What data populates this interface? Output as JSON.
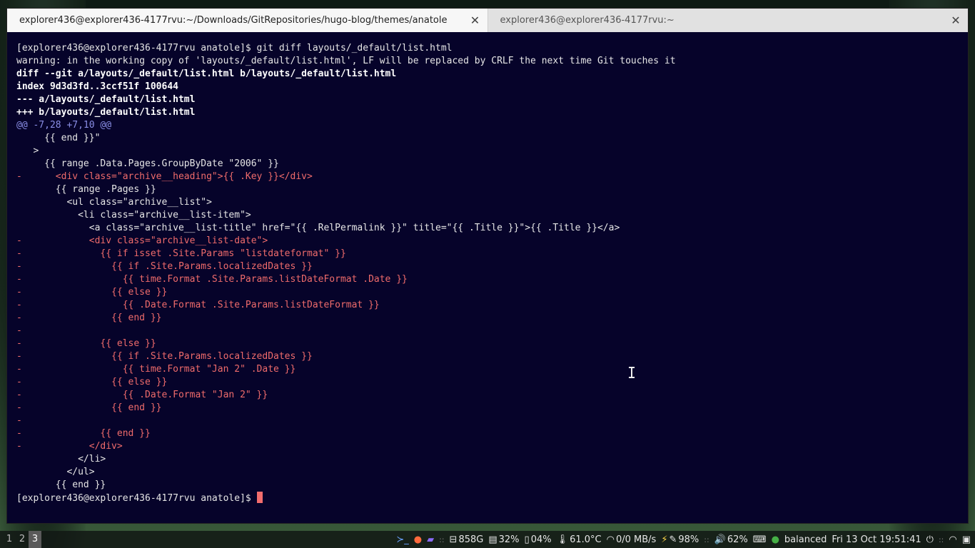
{
  "tabs": [
    {
      "title": "explorer436@explorer436-4177rvu:~/Downloads/GitRepositories/hugo-blog/themes/anatole",
      "active": true
    },
    {
      "title": "explorer436@explorer436-4177rvu:~",
      "active": false
    }
  ],
  "terminal_lines": [
    {
      "text": "[explorer436@explorer436-4177rvu anatole]$ git diff layouts/_default/list.html",
      "kind": "plain"
    },
    {
      "text": "warning: in the working copy of 'layouts/_default/list.html', LF will be replaced by CRLF the next time Git touches it",
      "kind": "plain"
    },
    {
      "text": "diff --git a/layouts/_default/list.html b/layouts/_default/list.html",
      "kind": "bold"
    },
    {
      "text": "index 9d3d3fd..3ccf51f 100644",
      "kind": "bold"
    },
    {
      "text": "--- a/layouts/_default/list.html",
      "kind": "bold"
    },
    {
      "text": "+++ b/layouts/_default/list.html",
      "kind": "bold"
    },
    {
      "text": "@@ -7,28 +7,10 @@",
      "kind": "hunk"
    },
    {
      "text": "     {{ end }}\"",
      "kind": "plain"
    },
    {
      "text": "   >",
      "kind": "plain"
    },
    {
      "text": "     {{ range .Data.Pages.GroupByDate \"2006\" }}",
      "kind": "plain"
    },
    {
      "text": "-      <div class=\"archive__heading\">{{ .Key }}</div>",
      "kind": "del"
    },
    {
      "text": "       {{ range .Pages }}",
      "kind": "plain"
    },
    {
      "text": "         <ul class=\"archive__list\">",
      "kind": "plain"
    },
    {
      "text": "           <li class=\"archive__list-item\">",
      "kind": "plain"
    },
    {
      "text": "             <a class=\"archive__list-title\" href=\"{{ .RelPermalink }}\" title=\"{{ .Title }}\">{{ .Title }}</a>",
      "kind": "plain"
    },
    {
      "text": "-            <div class=\"archive__list-date\">",
      "kind": "del"
    },
    {
      "text": "-              {{ if isset .Site.Params \"listdateformat\" }}",
      "kind": "del"
    },
    {
      "text": "-                {{ if .Site.Params.localizedDates }}",
      "kind": "del"
    },
    {
      "text": "-                  {{ time.Format .Site.Params.listDateFormat .Date }}",
      "kind": "del"
    },
    {
      "text": "-                {{ else }}",
      "kind": "del"
    },
    {
      "text": "-                  {{ .Date.Format .Site.Params.listDateFormat }}",
      "kind": "del"
    },
    {
      "text": "-                {{ end }}",
      "kind": "del"
    },
    {
      "text": "-",
      "kind": "del"
    },
    {
      "text": "-              {{ else }}",
      "kind": "del"
    },
    {
      "text": "-                {{ if .Site.Params.localizedDates }}",
      "kind": "del"
    },
    {
      "text": "-                  {{ time.Format \"Jan 2\" .Date }}",
      "kind": "del"
    },
    {
      "text": "-                {{ else }}",
      "kind": "del"
    },
    {
      "text": "-                  {{ .Date.Format \"Jan 2\" }}",
      "kind": "del"
    },
    {
      "text": "-                {{ end }}",
      "kind": "del"
    },
    {
      "text": "-",
      "kind": "del"
    },
    {
      "text": "-              {{ end }}",
      "kind": "del"
    },
    {
      "text": "-            </div>",
      "kind": "del"
    },
    {
      "text": "           </li>",
      "kind": "plain"
    },
    {
      "text": "         </ul>",
      "kind": "plain"
    },
    {
      "text": "       {{ end }}",
      "kind": "plain"
    }
  ],
  "prompt": "[explorer436@explorer436-4177rvu anatole]$ ",
  "taskbar": {
    "workspaces": [
      "1",
      "2",
      "3"
    ],
    "active_workspace": "3",
    "disk": "858G",
    "memory": "32%",
    "battery_small": "04%",
    "temperature": "61.0°C",
    "network": "0/0 MB/s",
    "battery": "98%",
    "volume": "62%",
    "power_profile": "balanced",
    "clock": "Fri 13 Oct 19:51:41"
  },
  "colors": {
    "terminal_bg": "#06032a",
    "deleted": "#ef6b6b",
    "hunk": "#8a8ee6",
    "cursor": "#f26d6d"
  }
}
